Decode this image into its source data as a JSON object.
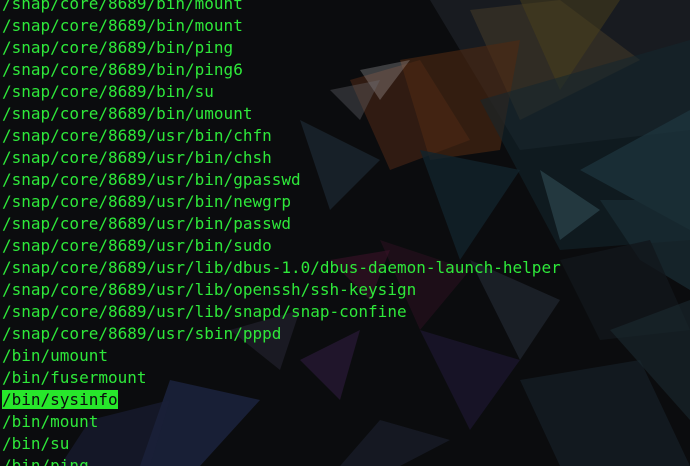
{
  "terminal": {
    "text_color": "#2ee83a",
    "highlight_color": "#27e72b",
    "lines": [
      {
        "text": "/snap/core/8689/bin/mount",
        "highlighted": false
      },
      {
        "text": "/snap/core/8689/bin/mount",
        "highlighted": false
      },
      {
        "text": "/snap/core/8689/bin/ping",
        "highlighted": false
      },
      {
        "text": "/snap/core/8689/bin/ping6",
        "highlighted": false
      },
      {
        "text": "/snap/core/8689/bin/su",
        "highlighted": false
      },
      {
        "text": "/snap/core/8689/bin/umount",
        "highlighted": false
      },
      {
        "text": "/snap/core/8689/usr/bin/chfn",
        "highlighted": false
      },
      {
        "text": "/snap/core/8689/usr/bin/chsh",
        "highlighted": false
      },
      {
        "text": "/snap/core/8689/usr/bin/gpasswd",
        "highlighted": false
      },
      {
        "text": "/snap/core/8689/usr/bin/newgrp",
        "highlighted": false
      },
      {
        "text": "/snap/core/8689/usr/bin/passwd",
        "highlighted": false
      },
      {
        "text": "/snap/core/8689/usr/bin/sudo",
        "highlighted": false
      },
      {
        "text": "/snap/core/8689/usr/lib/dbus-1.0/dbus-daemon-launch-helper",
        "highlighted": false
      },
      {
        "text": "/snap/core/8689/usr/lib/openssh/ssh-keysign",
        "highlighted": false
      },
      {
        "text": "/snap/core/8689/usr/lib/snapd/snap-confine",
        "highlighted": false
      },
      {
        "text": "/snap/core/8689/usr/sbin/pppd",
        "highlighted": false
      },
      {
        "text": "/bin/umount",
        "highlighted": false
      },
      {
        "text": "/bin/fusermount",
        "highlighted": false
      },
      {
        "text": "/bin/sysinfo",
        "highlighted": true
      },
      {
        "text": "/bin/mount",
        "highlighted": false
      },
      {
        "text": "/bin/su",
        "highlighted": false
      },
      {
        "text": "/bin/ping",
        "highlighted": false
      }
    ]
  }
}
